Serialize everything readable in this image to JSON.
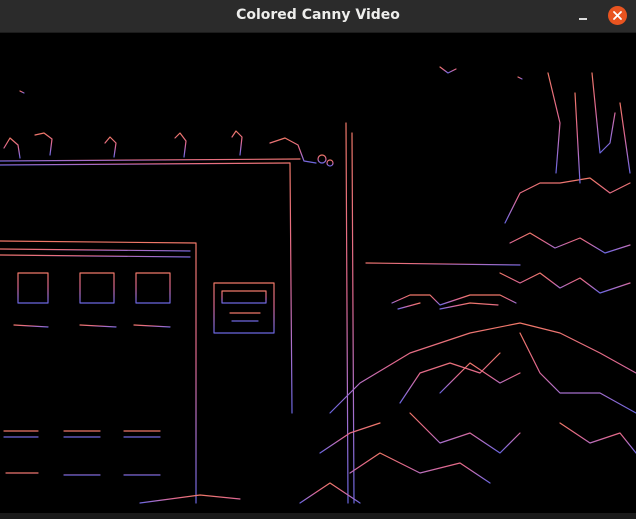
{
  "window": {
    "title": "Colored Canny Video",
    "controls": {
      "minimize_icon": "minimize-icon",
      "close_icon": "close-icon"
    },
    "accent_color": "#e95420",
    "titlebar_color": "#2b2b2b"
  },
  "video": {
    "content": "colored-canny-edge-frame",
    "background": "#000000",
    "edge_colors": [
      "#f07868",
      "#e06890",
      "#c070c0",
      "#8878d8",
      "#6a66e0"
    ]
  }
}
